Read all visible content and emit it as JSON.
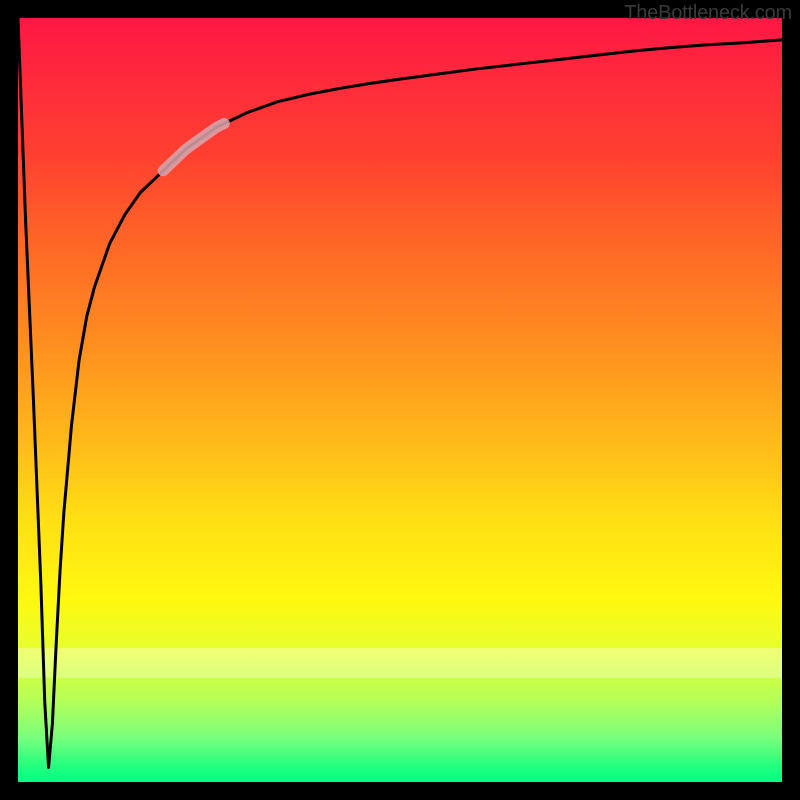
{
  "watermark": "TheBottleneck.com",
  "chart_data": {
    "type": "line",
    "title": "",
    "xlabel": "",
    "ylabel": "",
    "xlim": [
      0,
      100
    ],
    "ylim": [
      -5,
      100
    ],
    "grid": false,
    "legend": false,
    "notes": "Bottleneck-style curve: vertical drop near x≈0, sharp dip to near -3 around x≈4, then asymptotic rise toward ~97 as x→100. Gradient background encodes y from red (high) to green (low). A pale segment highlights x≈19–27.",
    "highlight_x_range": [
      19,
      27
    ],
    "series": [
      {
        "name": "bottleneck-curve",
        "x": [
          0,
          1,
          2,
          3,
          3.5,
          4,
          4.5,
          5,
          5.5,
          6,
          7,
          8,
          9,
          10,
          12,
          14,
          16,
          18,
          20,
          22,
          24,
          26,
          28,
          30,
          34,
          38,
          42,
          46,
          50,
          55,
          60,
          65,
          70,
          75,
          80,
          85,
          90,
          95,
          100
        ],
        "y": [
          100,
          72,
          48,
          22,
          6,
          -3,
          3,
          14,
          24,
          32,
          44,
          53,
          59,
          63,
          69,
          73,
          76,
          78,
          80,
          82,
          83.5,
          85,
          86,
          87,
          88.5,
          89.5,
          90.3,
          91,
          91.6,
          92.3,
          93,
          93.6,
          94.2,
          94.8,
          95.4,
          95.9,
          96.3,
          96.6,
          97
        ]
      }
    ]
  },
  "colors": {
    "frame": "#000000",
    "curve": "#000000",
    "highlight": "#d8a7af",
    "gradient_top": "#ff1744",
    "gradient_bottom": "#00ff85"
  }
}
